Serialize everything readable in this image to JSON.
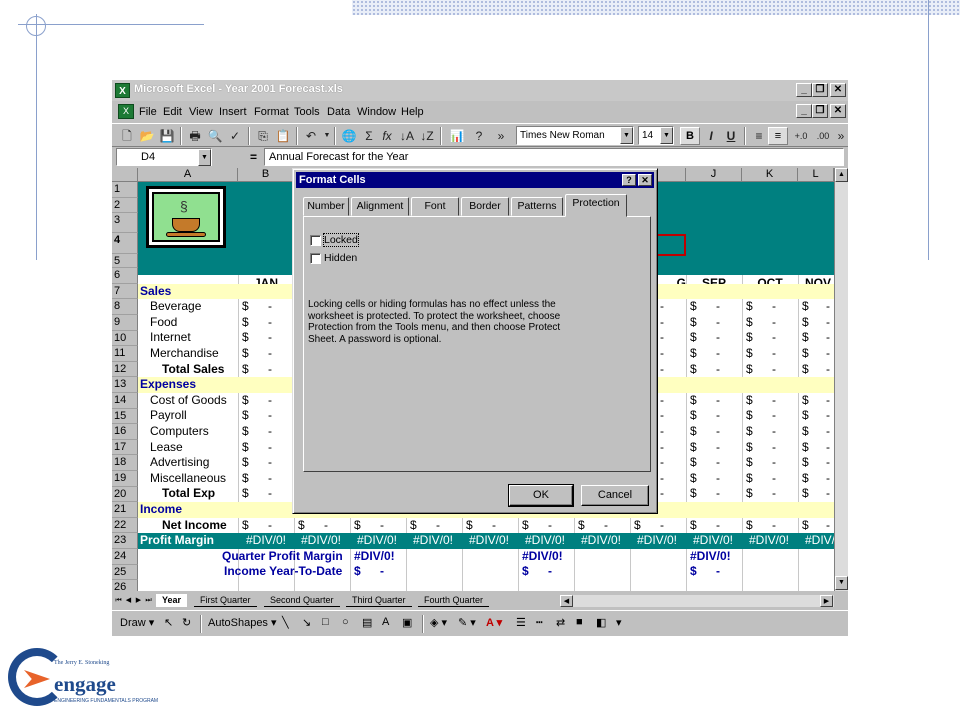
{
  "window": {
    "title": "Microsoft Excel - Year 2001 Forecast.xls",
    "controls": [
      "_",
      "❐",
      "✕"
    ]
  },
  "menu": {
    "items": [
      "File",
      "Edit",
      "View",
      "Insert",
      "Format",
      "Tools",
      "Data",
      "Window",
      "Help"
    ]
  },
  "toolbar": {
    "font_name": "Times New Roman",
    "font_size": "14",
    "bold": "B",
    "italic": "I",
    "underline": "U",
    "more": "»"
  },
  "formula_bar": {
    "cell_ref": "D4",
    "equals": "=",
    "content": "Annual Forecast for the Year"
  },
  "grid": {
    "columns": [
      "A",
      "B",
      "J",
      "K",
      "L"
    ],
    "rows": [
      "1",
      "2",
      "3",
      "4",
      "5",
      "6",
      "7",
      "8",
      "9",
      "10",
      "11",
      "12",
      "13",
      "14",
      "15",
      "16",
      "17",
      "18",
      "19",
      "20",
      "21",
      "22",
      "23",
      "24",
      "25",
      "26"
    ],
    "months": [
      "JAN",
      "G",
      "SEP",
      "OCT",
      "NOV"
    ],
    "sections": {
      "sales": "Sales",
      "expenses": "Expenses",
      "income": "Income",
      "profit_margin": "Profit Margin"
    },
    "labels": {
      "beverage": "Beverage",
      "food": "Food",
      "internet": "Internet",
      "merchandise": "Merchandise",
      "total_sales": "Total Sales",
      "cost_of_goods": "Cost of Goods",
      "payroll": "Payroll",
      "computers": "Computers",
      "lease": "Lease",
      "advertising": "Advertising",
      "miscellaneous": "Miscellaneous",
      "total_exp": "Total Exp",
      "net_income": "Net Income",
      "quarter_profit_margin": "Quarter Profit Margin",
      "income_ytd": "Income Year-To-Date"
    },
    "currency": "$",
    "dash": "-",
    "div_error": "#DIV/0!",
    "div_error_bang": "#DIV/0!",
    "cut_error": "#DIV/"
  },
  "sheet_tabs": [
    "Year",
    "First Quarter",
    "Second Quarter",
    "Third Quarter",
    "Fourth Quarter"
  ],
  "drawing_toolbar": {
    "draw": "Draw",
    "autoshapes": "AutoShapes"
  },
  "dialog": {
    "title": "Format Cells",
    "help": "?",
    "close": "✕",
    "tabs": [
      "Number",
      "Alignment",
      "Font",
      "Border",
      "Patterns",
      "Protection"
    ],
    "active_tab": "Protection",
    "locked_label": "Locked",
    "hidden_label": "Hidden",
    "note": "Locking cells or hiding formulas has no effect unless the worksheet is protected. To protect the worksheet, choose Protection from the Tools menu, and then choose Protect Sheet. A password is optional.",
    "ok": "OK",
    "cancel": "Cancel"
  },
  "logo": {
    "small": "The Jerry E. Stoneking",
    "word": "engage",
    "tag": "ENGINEERING FUNDAMENTALS PROGRAM"
  },
  "colors": {
    "teal": "#008080",
    "band_yellow": "#ffffc0",
    "dialog_title": "#000080",
    "section_blue": "#0000a0"
  }
}
